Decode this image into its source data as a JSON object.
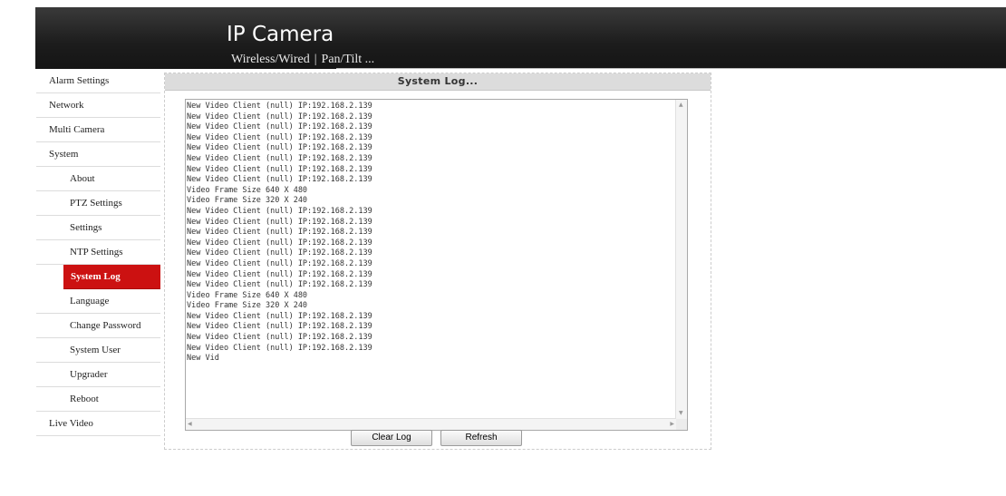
{
  "header": {
    "title": "IP Camera",
    "nav": [
      "Wireless/Wired",
      "Pan/Tilt ..."
    ],
    "separator": "|"
  },
  "sidebar": {
    "items": [
      {
        "label": "Alarm Settings"
      },
      {
        "label": "Network"
      },
      {
        "label": "Multi Camera"
      },
      {
        "label": "System"
      },
      {
        "label": "About"
      },
      {
        "label": "PTZ Settings"
      },
      {
        "label": "Settings"
      },
      {
        "label": "NTP Settings"
      },
      {
        "label": "System Log"
      },
      {
        "label": "Language"
      },
      {
        "label": "Change Password"
      },
      {
        "label": "System User"
      },
      {
        "label": "Upgrader"
      },
      {
        "label": "Reboot"
      },
      {
        "label": "Live Video"
      }
    ],
    "active": "System Log",
    "active_color": "#cc1111"
  },
  "panel": {
    "title": "System Log..."
  },
  "log": {
    "text": "New Video Client (null) IP:192.168.2.139\nNew Video Client (null) IP:192.168.2.139\nNew Video Client (null) IP:192.168.2.139\nNew Video Client (null) IP:192.168.2.139\nNew Video Client (null) IP:192.168.2.139\nNew Video Client (null) IP:192.168.2.139\nNew Video Client (null) IP:192.168.2.139\nNew Video Client (null) IP:192.168.2.139\nVideo Frame Size 640 X 480\nVideo Frame Size 320 X 240\nNew Video Client (null) IP:192.168.2.139\nNew Video Client (null) IP:192.168.2.139\nNew Video Client (null) IP:192.168.2.139\nNew Video Client (null) IP:192.168.2.139\nNew Video Client (null) IP:192.168.2.139\nNew Video Client (null) IP:192.168.2.139\nNew Video Client (null) IP:192.168.2.139\nNew Video Client (null) IP:192.168.2.139\nVideo Frame Size 640 X 480\nVideo Frame Size 320 X 240\nNew Video Client (null) IP:192.168.2.139\nNew Video Client (null) IP:192.168.2.139\nNew Video Client (null) IP:192.168.2.139\nNew Video Client (null) IP:192.168.2.139\nNew Vid"
  },
  "buttons": {
    "clear_log": "Clear Log",
    "refresh": "Refresh"
  }
}
